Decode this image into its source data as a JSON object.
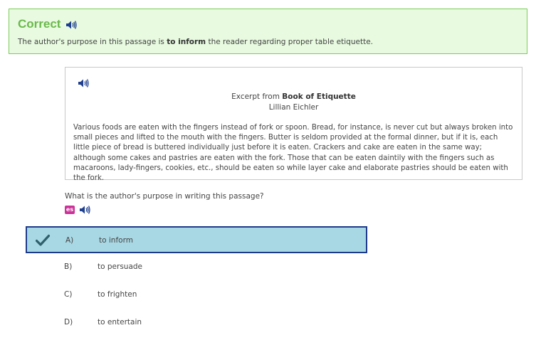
{
  "feedback": {
    "title": "Correct",
    "msg_before": "The author's purpose in this passage is ",
    "msg_bold": "to inform",
    "msg_after": " the reader regarding proper table etiquette."
  },
  "passage": {
    "heading_prefix": "Excerpt from ",
    "heading_book": "Book of Etiquette",
    "author": "Lillian Eichler",
    "body": "Various foods are eaten with the fingers instead of fork or spoon. Bread, for instance, is never cut but always broken into small pieces and lifted to the mouth with the fingers. Butter is seldom provided at the formal dinner, but if it is, each little piece of bread is buttered individually just before it is eaten. Crackers and cake are eaten in the same way; although some cakes and pastries are eaten with the fork. Those that can be eaten daintily with the fingers such as macaroons, lady-fingers, cookies, etc., should be eaten so while layer cake and elaborate pastries should be eaten with the fork."
  },
  "question": {
    "text": "What is the author's purpose in writing this passage?",
    "es_label": "es"
  },
  "choices": [
    {
      "letter": "A)",
      "text": "to inform",
      "selected": true
    },
    {
      "letter": "B)",
      "text": "to persuade",
      "selected": false
    },
    {
      "letter": "C)",
      "text": "to frighten",
      "selected": false
    },
    {
      "letter": "D)",
      "text": "to entertain",
      "selected": false
    }
  ],
  "colors": {
    "correct_green": "#6ab94a",
    "feedback_bg": "#e8fbe0",
    "selected_bg": "#a8d8e4",
    "selected_border": "#1e3a8a",
    "speaker_blue": "#1f3f8f",
    "es_badge": "#cc3399",
    "check_color": "#2e5f6b"
  },
  "icons": {
    "speaker": "speaker-icon",
    "check": "checkmark-icon",
    "language": "spanish-language-icon"
  }
}
